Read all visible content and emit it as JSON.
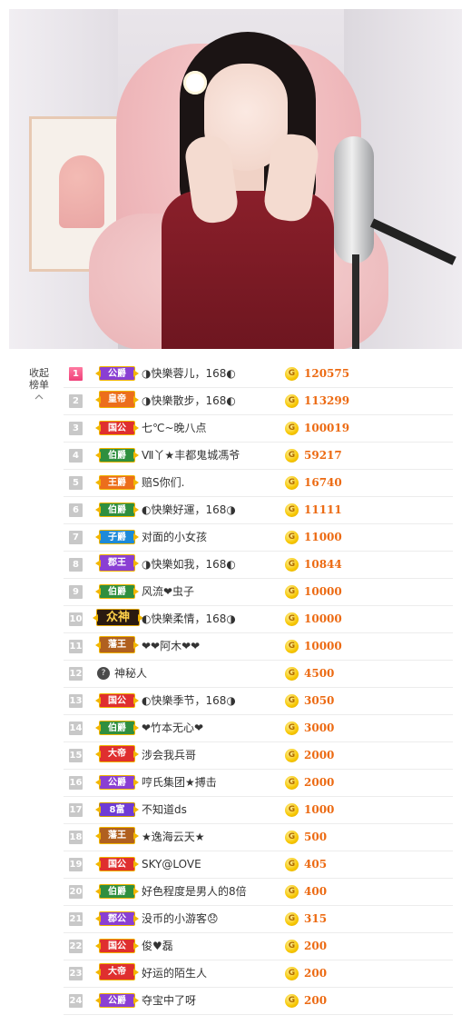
{
  "video": {
    "alt": "streamer video frame"
  },
  "sidebar": {
    "collapse_line1": "收起",
    "collapse_line2": "榜单"
  },
  "coin_symbol": "G",
  "rows": [
    {
      "rank": "1",
      "badge": "公爵",
      "badge_color": "purple",
      "crown": false,
      "name": "◑快樂蓉儿，168◐",
      "score": "120575"
    },
    {
      "rank": "2",
      "badge": "皇帝",
      "badge_color": "orange",
      "crown": true,
      "name": "◑快樂散步，168◐",
      "score": "113299"
    },
    {
      "rank": "3",
      "badge": "国公",
      "badge_color": "red",
      "crown": false,
      "name": "七℃~晚八点",
      "score": "100019"
    },
    {
      "rank": "4",
      "badge": "伯爵",
      "badge_color": "green",
      "crown": false,
      "name": "Ⅶ丫★丰都鬼城馮爷",
      "score": "59217"
    },
    {
      "rank": "5",
      "badge": "王爵",
      "badge_color": "orange",
      "crown": false,
      "name": "赔S你们.",
      "score": "16740"
    },
    {
      "rank": "6",
      "badge": "伯爵",
      "badge_color": "green",
      "crown": false,
      "name": "◐快樂好運，168◑",
      "score": "11111"
    },
    {
      "rank": "7",
      "badge": "子爵",
      "badge_color": "blue",
      "crown": false,
      "name": "对面的小女孩",
      "score": "11000"
    },
    {
      "rank": "8",
      "badge": "郡王",
      "badge_color": "purple",
      "crown": true,
      "name": "◑快樂如我，168◐",
      "score": "10844"
    },
    {
      "rank": "9",
      "badge": "伯爵",
      "badge_color": "green",
      "crown": false,
      "name": "风流❤虫子",
      "score": "10000"
    },
    {
      "rank": "10",
      "badge": "众神",
      "badge_color": "god",
      "crown": true,
      "name": "◐快樂柔情，168◑",
      "score": "10000"
    },
    {
      "rank": "11",
      "badge": "藩王",
      "badge_color": "brown",
      "crown": true,
      "name": "❤❤阿木❤❤",
      "score": "10000"
    },
    {
      "rank": "12",
      "badge": "",
      "badge_color": "secret",
      "crown": false,
      "name": "神秘人",
      "score": "4500"
    },
    {
      "rank": "13",
      "badge": "国公",
      "badge_color": "red",
      "crown": false,
      "name": "◐快樂季节，168◑",
      "score": "3050"
    },
    {
      "rank": "14",
      "badge": "伯爵",
      "badge_color": "green",
      "crown": false,
      "name": "❤竹本无心❤",
      "score": "3000"
    },
    {
      "rank": "15",
      "badge": "大帝",
      "badge_color": "red",
      "crown": true,
      "name": "涉会我兵哥",
      "score": "2000"
    },
    {
      "rank": "16",
      "badge": "公爵",
      "badge_color": "purple",
      "crown": false,
      "name": "哼氏集团★搏击",
      "score": "2000"
    },
    {
      "rank": "17",
      "badge": "8富",
      "badge_color": "violet",
      "crown": false,
      "name": "不知道ds",
      "score": "1000"
    },
    {
      "rank": "18",
      "badge": "藩王",
      "badge_color": "brown",
      "crown": true,
      "name": "★逸海云天★",
      "score": "500"
    },
    {
      "rank": "19",
      "badge": "国公",
      "badge_color": "red",
      "crown": false,
      "name": "SKY@LOVE",
      "score": "405"
    },
    {
      "rank": "20",
      "badge": "伯爵",
      "badge_color": "green",
      "crown": false,
      "name": "好色程度是男人的8倍",
      "score": "400"
    },
    {
      "rank": "21",
      "badge": "郡公",
      "badge_color": "purple",
      "crown": false,
      "name": "没币的小游客😞",
      "score": "315"
    },
    {
      "rank": "22",
      "badge": "国公",
      "badge_color": "red",
      "crown": false,
      "name": "俊♥磊",
      "score": "200"
    },
    {
      "rank": "23",
      "badge": "大帝",
      "badge_color": "red",
      "crown": true,
      "name": "好运的陌生人",
      "score": "200"
    },
    {
      "rank": "24",
      "badge": "公爵",
      "badge_color": "purple",
      "crown": false,
      "name": "夺宝中了呀",
      "score": "200"
    }
  ],
  "colors": {
    "score": "#ec6a12",
    "rank_first": "#ef3f78",
    "rank_default": "#c8c8c8"
  }
}
